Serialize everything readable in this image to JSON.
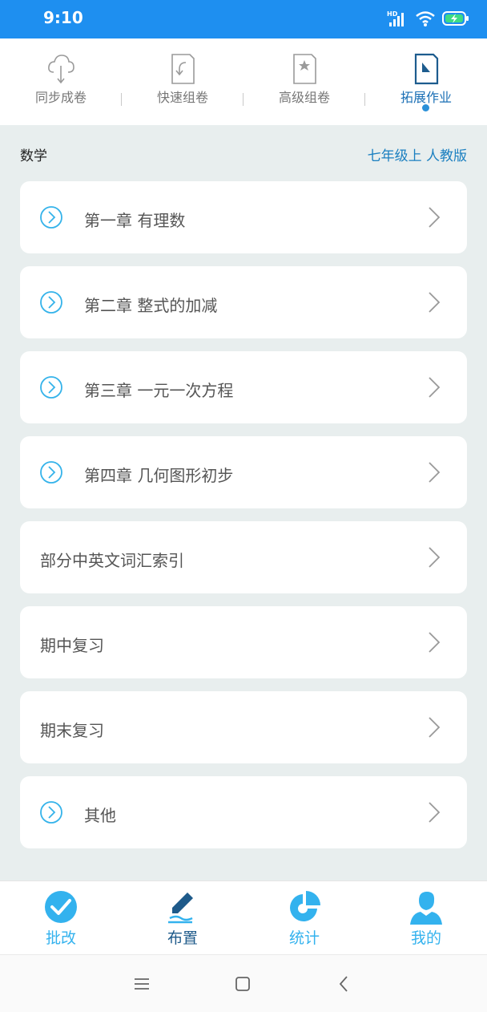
{
  "status_bar": {
    "time": "9:10",
    "network_label": "HD"
  },
  "top_tabs": [
    {
      "label": "同步成卷",
      "icon": "cloud-download-icon",
      "active": false
    },
    {
      "label": "快速组卷",
      "icon": "quick-paper-icon",
      "active": false
    },
    {
      "label": "高级组卷",
      "icon": "star-paper-icon",
      "active": false
    },
    {
      "label": "拓展作业",
      "icon": "extend-homework-icon",
      "active": true
    }
  ],
  "header": {
    "subject": "数学",
    "grade": "七年级上 人教版"
  },
  "chapters": [
    {
      "label": "第一章 有理数",
      "expandable": true
    },
    {
      "label": "第二章 整式的加减",
      "expandable": true
    },
    {
      "label": "第三章 一元一次方程",
      "expandable": true
    },
    {
      "label": "第四章 几何图形初步",
      "expandable": true
    },
    {
      "label": "部分中英文词汇索引",
      "expandable": false
    },
    {
      "label": "期中复习",
      "expandable": false
    },
    {
      "label": "期末复习",
      "expandable": false
    },
    {
      "label": "其他",
      "expandable": true
    }
  ],
  "bottom_nav": [
    {
      "label": "批改",
      "icon": "check-circle-icon",
      "active": false
    },
    {
      "label": "布置",
      "icon": "pen-icon",
      "active": true
    },
    {
      "label": "统计",
      "icon": "pie-chart-icon",
      "active": false
    },
    {
      "label": "我的",
      "icon": "user-icon",
      "active": false
    }
  ],
  "colors": {
    "accent": "#1e8ff0",
    "link": "#1a7fc0",
    "nav_active": "#1e5a8a",
    "nav_icon": "#33b2ee"
  }
}
